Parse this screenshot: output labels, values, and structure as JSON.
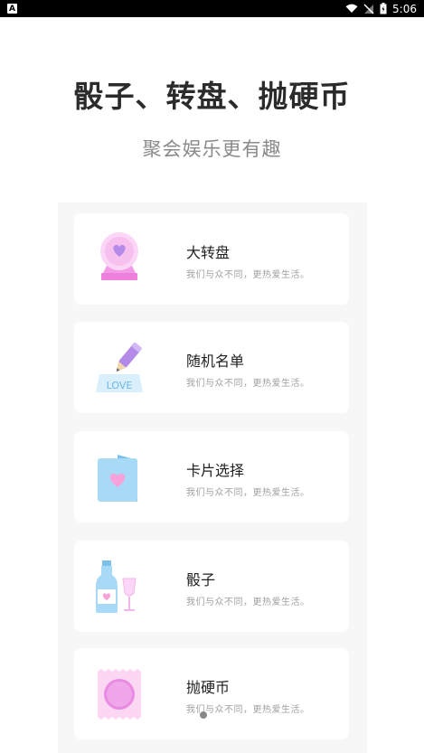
{
  "status_bar": {
    "app_badge": "A",
    "time": "5:06"
  },
  "header": {
    "title": "骰子、转盘、抛硬币",
    "subtitle": "聚会娱乐更有趣"
  },
  "items": [
    {
      "title": "大转盘",
      "desc": "我们与众不同，更热爱生活。",
      "icon": "crystal-ball-icon"
    },
    {
      "title": "随机名单",
      "desc": "我们与众不同，更热爱生活。",
      "icon": "love-pencil-icon"
    },
    {
      "title": "卡片选择",
      "desc": "我们与众不同，更热爱生活。",
      "icon": "heart-card-icon"
    },
    {
      "title": "骰子",
      "desc": "我们与众不同，更热爱生活。",
      "icon": "wine-bottle-icon"
    },
    {
      "title": "抛硬币",
      "desc": "我们与众不同，更热爱生活。",
      "icon": "coin-icon"
    }
  ],
  "colors": {
    "accent_pink": "#f08fe0",
    "accent_purple": "#b79af0",
    "accent_blue": "#9fd3f5"
  }
}
